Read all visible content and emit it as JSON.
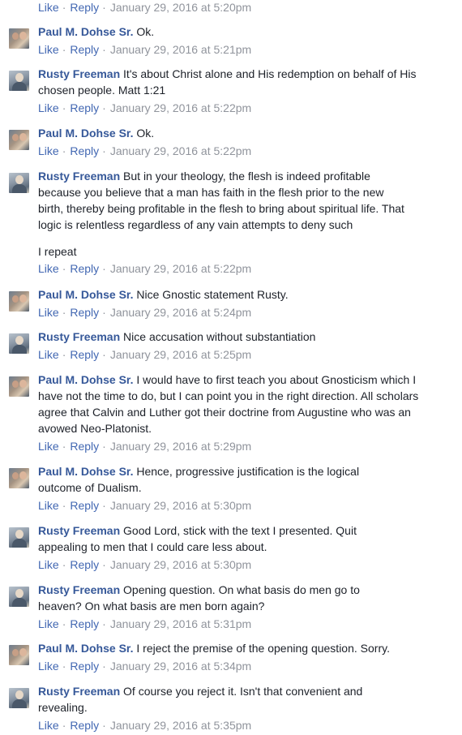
{
  "actions": {
    "like": "Like",
    "reply": "Reply",
    "separator": "·"
  },
  "comments": [
    {
      "author": "",
      "text": "",
      "timestamp": "January 29, 2016 at 5:20pm"
    },
    {
      "author": "Paul M. Dohse Sr.",
      "text": "Ok.",
      "timestamp": "January 29, 2016 at 5:21pm"
    },
    {
      "author": "Rusty Freeman",
      "text": "It's about Christ alone and His redemption on behalf of His chosen people. Matt 1:21",
      "timestamp": "January 29, 2016 at 5:22pm"
    },
    {
      "author": "Paul M. Dohse Sr.",
      "text": "Ok.",
      "timestamp": "January 29, 2016 at 5:22pm"
    },
    {
      "author": "Rusty Freeman",
      "text": "But in your theology, the flesh is indeed profitable because you believe that a man has faith in the flesh prior to the new birth, thereby being profitable in the flesh to bring about spiritual life. That logic is relentless regardless of any vain attempts to deny such",
      "text2": "I repeat",
      "timestamp": "January 29, 2016 at 5:22pm"
    },
    {
      "author": "Paul M. Dohse Sr.",
      "text": "Nice Gnostic statement Rusty.",
      "timestamp": "January 29, 2016 at 5:24pm"
    },
    {
      "author": "Rusty Freeman",
      "text": "Nice accusation without substantiation",
      "timestamp": "January 29, 2016 at 5:25pm"
    },
    {
      "author": "Paul M. Dohse Sr.",
      "text": "I would have to first teach you about Gnosticism which I have not the time to do, but I can point you in the right direction. All scholars agree that Calvin and Luther got their doctrine from Augustine who was an avowed Neo-Platonist.",
      "timestamp": "January 29, 2016 at 5:29pm"
    },
    {
      "author": "Paul M. Dohse Sr.",
      "text": "Hence, progressive justification is the logical outcome of Dualism.",
      "timestamp": "January 29, 2016 at 5:30pm"
    },
    {
      "author": "Rusty Freeman",
      "text": "Good Lord, stick with the text I presented. Quit appealing to men that I could care less about.",
      "timestamp": "January 29, 2016 at 5:30pm"
    },
    {
      "author": "Rusty Freeman",
      "text": "Opening question. On what basis do men go to heaven? On what basis are men born again?",
      "timestamp": "January 29, 2016 at 5:31pm"
    },
    {
      "author": "Paul M. Dohse Sr.",
      "text": "I reject the premise of the opening question. Sorry.",
      "timestamp": "January 29, 2016 at 5:34pm"
    },
    {
      "author": "Rusty Freeman",
      "text": "Of course you reject it. Isn't that convenient and revealing.",
      "timestamp": "January 29, 2016 at 5:35pm"
    }
  ]
}
